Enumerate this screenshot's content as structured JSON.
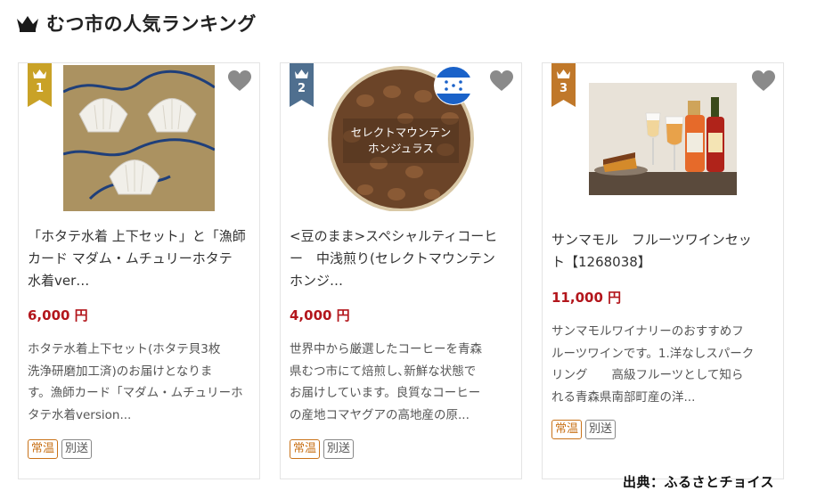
{
  "header": {
    "title": "むつ市の人気ランキング",
    "icon": "crown-icon"
  },
  "cards": [
    {
      "rank": "1",
      "rank_color": "#c9a227",
      "title": "「ホタテ水着 上下セット」と「漁師カード マダム・ムチュリーホタテ水着ver…",
      "title_lines": [
        "「ホタテ水着 上下セット」と「漁師",
        "カード マダム・ムチュリーホタテ",
        "水着ver…"
      ],
      "price": "6,000 円",
      "description_lines": [
        "ホタテ水着上下セット(ホタテ貝3枚",
        "洗浄研磨加工済)のお届けとなりま",
        "す。漁師カード「マダム・ムチュリーホ",
        "タテ水着version..."
      ],
      "tags": [
        "常温",
        "別送"
      ]
    },
    {
      "rank": "2",
      "rank_color": "#4f6f8f",
      "image_text": [
        "セレクトマウンテン",
        "ホンジュラス"
      ],
      "title_lines": [
        "<豆のまま>スペシャルティコーヒ",
        "ー　中浅煎り(セレクトマウンテン",
        "ホンジ…"
      ],
      "price": "4,000 円",
      "description_lines": [
        "世界中から厳選したコーヒーを青森",
        "県むつ市にて焙煎し､新鮮な状態で",
        "お届けしています。良質なコーヒー",
        "の産地コマヤグアの高地産の原..."
      ],
      "tags": [
        "常温",
        "別送"
      ]
    },
    {
      "rank": "3",
      "rank_color": "#c0782a",
      "title_lines": [
        "サンマモル　フルーツワインセッ",
        "ト【1268038】"
      ],
      "price": "11,000 円",
      "description_lines": [
        "サンマモルワイナリーのおすすめフ",
        "ルーツワインです。1.洋なしスパーク",
        "リング　　高級フルーツとして知ら",
        "れる青森県南部町産の洋..."
      ],
      "tags": [
        "常温",
        "別送"
      ]
    }
  ],
  "credit": "出典：ふるさとチョイス",
  "colors": {
    "price": "#b3161c",
    "tag_normal": "#c9731a",
    "heart": "#8a8a8a"
  }
}
